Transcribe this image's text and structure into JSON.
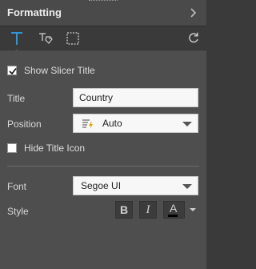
{
  "header": {
    "title": "Formatting"
  },
  "tabs": [
    {
      "icon": "text-format-icon"
    },
    {
      "icon": "tag-edit-icon"
    },
    {
      "icon": "border-box-icon"
    }
  ],
  "show_title": {
    "label": "Show Slicer Title",
    "checked": true
  },
  "title_field": {
    "label": "Title",
    "value": "Country"
  },
  "position_field": {
    "label": "Position",
    "value": "Auto"
  },
  "hide_title_icon": {
    "label": "Hide Title Icon",
    "checked": false
  },
  "font_field": {
    "label": "Font",
    "value": "Segoe UI"
  },
  "style_field": {
    "label": "Style",
    "bold": "B",
    "italic": "I",
    "color_letter": "A",
    "text_color": "#000000"
  },
  "colors": {
    "accent": "#2e95d8"
  }
}
